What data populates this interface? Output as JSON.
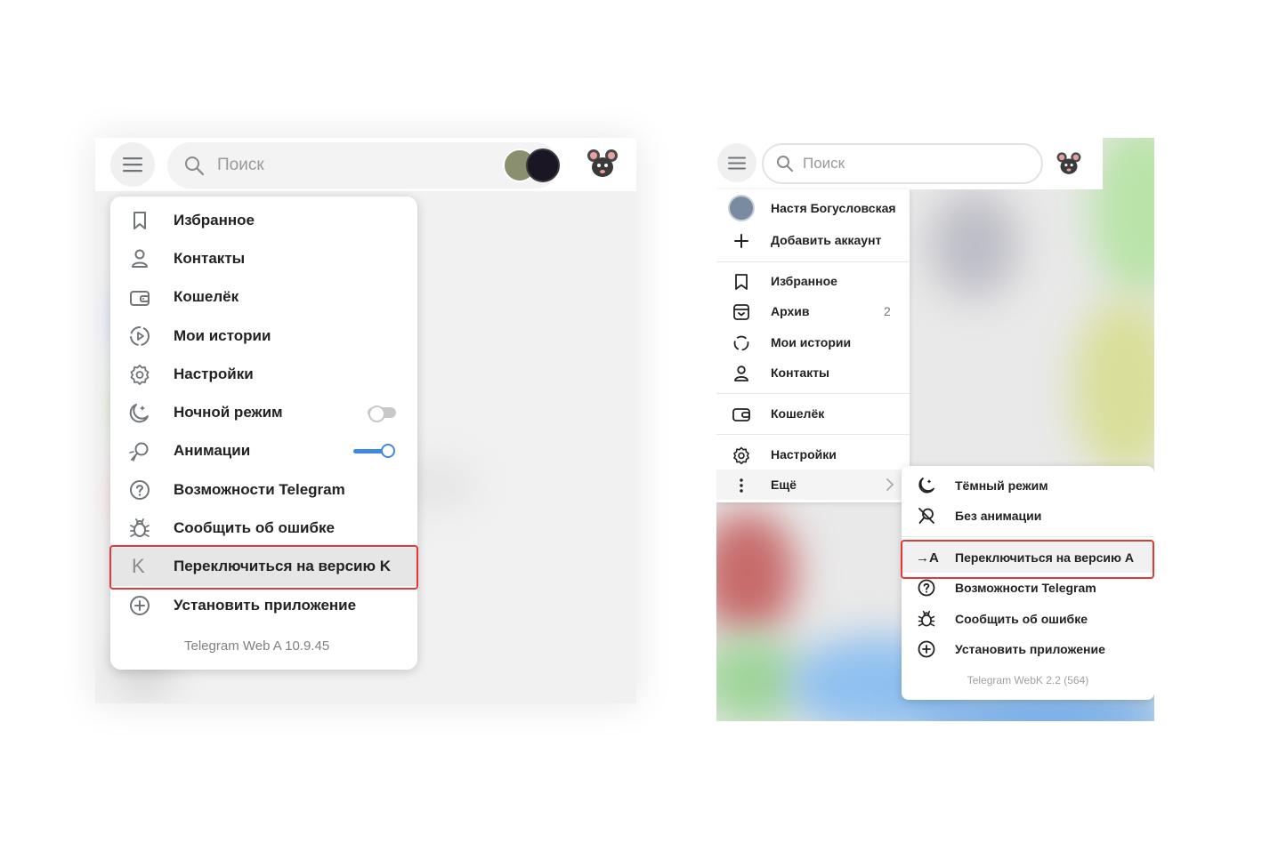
{
  "left_app": {
    "search": {
      "placeholder": "Поиск"
    },
    "menu": {
      "items": [
        {
          "label": "Избранное",
          "icon": "bookmark-icon"
        },
        {
          "label": "Контакты",
          "icon": "user-icon"
        },
        {
          "label": "Кошелёк",
          "icon": "wallet-icon"
        },
        {
          "label": "Мои истории",
          "icon": "stories-icon"
        },
        {
          "label": "Настройки",
          "icon": "gear-icon"
        },
        {
          "label": "Ночной режим",
          "icon": "moon-icon",
          "toggle": false
        },
        {
          "label": "Анимации",
          "icon": "animation-icon",
          "toggle": true
        },
        {
          "label": "Возможности Telegram",
          "icon": "question-icon"
        },
        {
          "label": "Сообщить об ошибке",
          "icon": "bug-icon"
        },
        {
          "label": "Переключиться на версию K",
          "icon": "letter-k-icon",
          "highlighted": true
        },
        {
          "label": "Установить приложение",
          "icon": "plus-circle-icon"
        }
      ],
      "version": "Telegram Web A 10.9.45",
      "switch_glyph": "K"
    }
  },
  "right_app": {
    "search": {
      "placeholder": "Поиск"
    },
    "menu": {
      "account": {
        "name": "Настя Богусловская",
        "add_label": "Добавить аккаунт"
      },
      "items": [
        {
          "label": "Избранное",
          "icon": "bookmark-icon"
        },
        {
          "label": "Архив",
          "icon": "archive-icon",
          "count": "2"
        },
        {
          "label": "Мои истории",
          "icon": "stories-icon"
        },
        {
          "label": "Контакты",
          "icon": "user-icon"
        },
        {
          "label": "Кошелёк",
          "icon": "wallet-icon"
        },
        {
          "label": "Настройки",
          "icon": "gear-icon"
        },
        {
          "label": "Ещё",
          "icon": "more-vertical-icon"
        }
      ]
    },
    "submenu": {
      "items": [
        {
          "label": "Тёмный режим",
          "icon": "moon-icon"
        },
        {
          "label": "Без анимации",
          "icon": "no-animation-icon"
        },
        {
          "label": "Переключиться на версию А",
          "icon": "switch-a-icon",
          "highlighted": true
        },
        {
          "label": "Возможности Telegram",
          "icon": "question-icon"
        },
        {
          "label": "Сообщить об ошибке",
          "icon": "bug-icon"
        },
        {
          "label": "Установить приложение",
          "icon": "plus-circle-icon"
        }
      ],
      "version": "Telegram WebK 2.2 (564)",
      "switch_glyph": "→A"
    }
  },
  "colors": {
    "highlight_border": "#e53935",
    "toggle_on": "#3f8ae0",
    "toggle_off": "#c8c8c8",
    "icon_stroke": "#707579"
  }
}
